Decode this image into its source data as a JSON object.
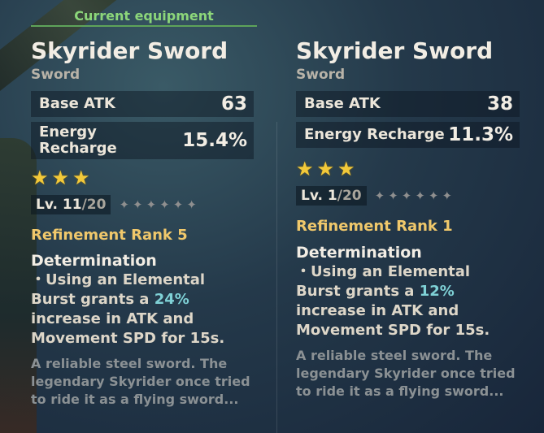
{
  "current_label": "Current equipment",
  "left": {
    "name": "Skyrider Sword",
    "type": "Sword",
    "base_atk_label": "Base ATK",
    "base_atk_value": "63",
    "sub_label_line1": "Energy",
    "sub_label_line2": "Recharge",
    "sub_value": "15.4%",
    "stars": 3,
    "level_current": "Lv. 11",
    "level_max": "/20",
    "refinement": "Refinement Rank 5",
    "passive_name": "Determination",
    "passive_pre": "・Using an Elemental Burst grants a ",
    "passive_value": "24%",
    "passive_post": " increase in ATK and Movement SPD for 15s.",
    "flavor": "A reliable steel sword. The legendary Skyrider once tried to ride it as a flying sword..."
  },
  "right": {
    "name": "Skyrider Sword",
    "type": "Sword",
    "base_atk_label": "Base ATK",
    "base_atk_value": "38",
    "sub_label": "Energy Recharge",
    "sub_value": "11.3%",
    "stars": 3,
    "level_current": "Lv. 1",
    "level_max": "/20",
    "refinement": "Refinement Rank 1",
    "passive_name": "Determination",
    "passive_pre": "・Using an Elemental Burst grants a ",
    "passive_value": "12%",
    "passive_post": " increase in ATK and Movement SPD for 15s.",
    "flavor": "A reliable steel sword. The legendary Skyrider once tried to ride it as a flying sword..."
  },
  "colors": {
    "accent_green": "#8cd67a",
    "star_gold": "#f2c93a",
    "refinement_gold": "#f0c86b",
    "highlight_cyan": "#7fd1d6"
  }
}
